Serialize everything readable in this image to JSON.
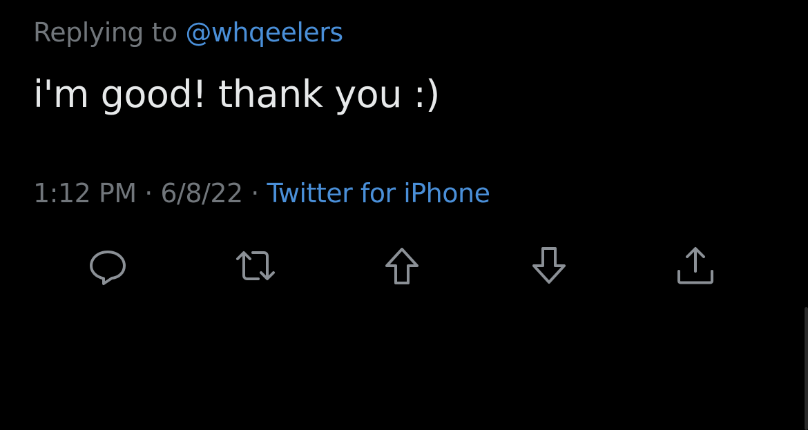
{
  "reply": {
    "prefix": "Replying to",
    "mention": "@whqeelers"
  },
  "tweet": {
    "text": "i'm good! thank you :)"
  },
  "meta": {
    "time": "1:12 PM",
    "separator1": " · ",
    "date": "6/8/22",
    "separator2": " · ",
    "source": "Twitter for iPhone"
  },
  "actions": [
    {
      "name": "reply",
      "icon": "comment-icon"
    },
    {
      "name": "retweet",
      "icon": "retweet-icon"
    },
    {
      "name": "upvote",
      "icon": "arrow-up-icon"
    },
    {
      "name": "downvote",
      "icon": "arrow-down-icon"
    },
    {
      "name": "share",
      "icon": "share-icon"
    }
  ],
  "colors": {
    "background": "#000000",
    "text": "#e7e9ea",
    "muted": "#71767b",
    "link": "#4a8fd8",
    "icon": "#8b9096"
  }
}
